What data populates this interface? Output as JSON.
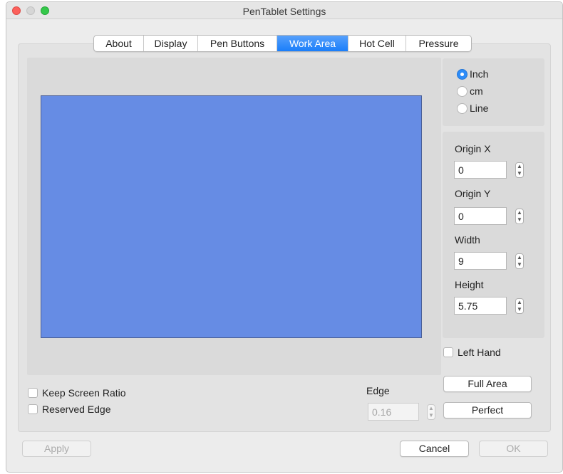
{
  "window": {
    "title": "PenTablet Settings"
  },
  "tabs": [
    {
      "label": "About",
      "active": false
    },
    {
      "label": "Display",
      "active": false
    },
    {
      "label": "Pen Buttons",
      "active": false
    },
    {
      "label": "Work Area",
      "active": true
    },
    {
      "label": "Hot Cell",
      "active": false
    },
    {
      "label": "Pressure",
      "active": false
    }
  ],
  "units": {
    "options": [
      "Inch",
      "cm",
      "Line"
    ],
    "selected": "Inch"
  },
  "fields": {
    "origin_x": {
      "label": "Origin X",
      "value": "0"
    },
    "origin_y": {
      "label": "Origin Y",
      "value": "0"
    },
    "width": {
      "label": "Width",
      "value": "9"
    },
    "height": {
      "label": "Height",
      "value": "5.75"
    }
  },
  "checkboxes": {
    "left_hand": {
      "label": "Left Hand",
      "checked": false
    },
    "keep_screen_ratio": {
      "label": "Keep Screen Ratio",
      "checked": false
    },
    "reserved_edge": {
      "label": "Reserved Edge",
      "checked": false
    }
  },
  "edge": {
    "label": "Edge",
    "value": "0.16"
  },
  "buttons": {
    "full_area": "Full Area",
    "perfect": "Perfect",
    "apply": "Apply",
    "cancel": "Cancel",
    "ok": "OK"
  },
  "colors": {
    "work_area_fill": "#668ce4",
    "accent": "#1a7efa"
  }
}
